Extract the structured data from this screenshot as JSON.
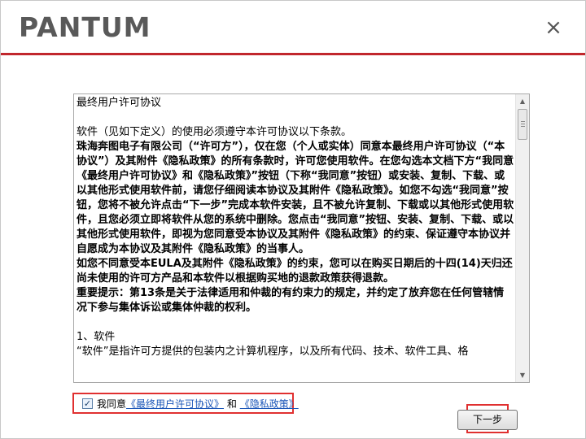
{
  "header": {
    "brand": "PANTUM",
    "close_symbol": "×",
    "accent_color": "#c1272d"
  },
  "document": {
    "title": "最终用户许可协议",
    "intro": "软件（见如下定义）的使用必须遵守本许可协议以下条款。",
    "bold_paragraph": "珠海奔图电子有限公司（“许可方”），仅在您（个人或实体）同意本最终用户许可协议（“本协议”）及其附件《隐私政策》的所有条款时，许可您使用软件。在您勾选本文档下方“我同意《最终用户许可协议》和《隐私政策》”按钮（下称“我同意”按钮）或安装、复制、下载、或以其他形式使用软件前，请您仔细阅读本协议及其附件《隐私政策》。如您不勾选“我同意”按钮，您将不被允许点击“下一步”完成本软件安装，且不被允许复制、下载或以其他形式使用软件，且您必须立即将软件从您的系统中删除。您点击“我同意”按钮、安装、复制、下载、或以其他形式使用软件，即视为您同意受本协议及其附件《隐私政策》的约束、保证遵守本协议并自愿成为本协议及其附件《隐私政策》的当事人。",
    "bold_paragraph_2": "如您不同意受本EULA及其附件《隐私政策》的约束，您可以在购买日期后的十四(14)天归还尚未使用的许可方产品和本软件以根据购买地的退款政策获得退款。",
    "bold_paragraph_3": "重要提示：第13条是关于法律适用和仲裁的有约束力的规定，并约定了放弃您在任何管辖情况下参与集体诉讼或集体仲裁的权利。",
    "section_1_title": "1、软件",
    "section_1_text": "“软件”是指许可方提供的包装内之计算机程序，以及所有代码、技术、软件工具、格"
  },
  "agreement": {
    "checked": true,
    "check_symbol": "✓",
    "prefix": "我同意",
    "eula_link": "《最终用户许可协议》",
    "conjunction": "和",
    "privacy_link": "《隐私政策》"
  },
  "footer": {
    "next_label": "下一步"
  },
  "scrollbar": {
    "up_symbol": "▲",
    "down_symbol": "▼"
  }
}
